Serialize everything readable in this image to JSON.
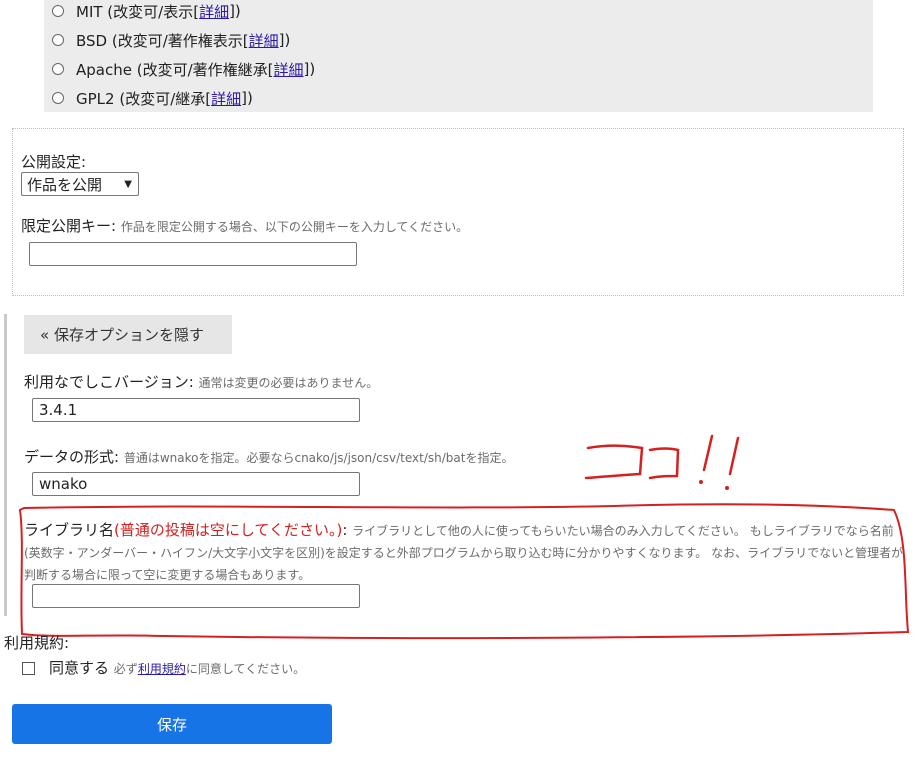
{
  "license": {
    "options": [
      {
        "name": "MIT (改変可/表示[",
        "link": "詳細",
        "close": "])"
      },
      {
        "name": "BSD (改変可/著作権表示[",
        "link": "詳細",
        "close": "])"
      },
      {
        "name": "Apache (改変可/著作権継承[",
        "link": "詳細",
        "close": "])"
      },
      {
        "name": "GPL2 (改変可/継承[",
        "link": "詳細",
        "close": "])"
      }
    ]
  },
  "publish": {
    "label": "公開設定:",
    "selected": "作品を公開",
    "key_label": "限定公開キー:",
    "key_hint": "作品を限定公開する場合、以下の公開キーを入力してください。",
    "key_value": ""
  },
  "options": {
    "toggle_label": "« 保存オプションを隠す",
    "version_label": "利用なでしこバージョン:",
    "version_hint": "通常は変更の必要はありません。",
    "version_value": "3.4.1",
    "format_label": "データの形式:",
    "format_hint": "普通はwnakoを指定。必要ならcnako/js/json/csv/text/sh/batを指定。",
    "format_value": "wnako",
    "library_label": "ライブラリ名",
    "library_warning": "(普通の投稿は空にしてください。)",
    "library_colon": ":",
    "library_hint": "ライブラリとして他の人に使ってもらいたい場合のみ入力してください。 もしライブラリでなら名前(英数字・アンダーバー・ハイフン/大文字小文字を区別)を設定すると外部プログラムから取り込む時に分かりやすくなります。 なお、ライブラリでないと管理者が判断する場合に限って空に変更する場合もあります。",
    "library_value": ""
  },
  "terms": {
    "label": "利用規約:",
    "agree_label": "同意する",
    "hint_prefix": "必ず",
    "link": "利用規約",
    "hint_suffix": "に同意してください。"
  },
  "save_label": "保存",
  "colors": {
    "accent": "#1774e6",
    "warning": "#d62020",
    "annotation": "#d62020"
  }
}
